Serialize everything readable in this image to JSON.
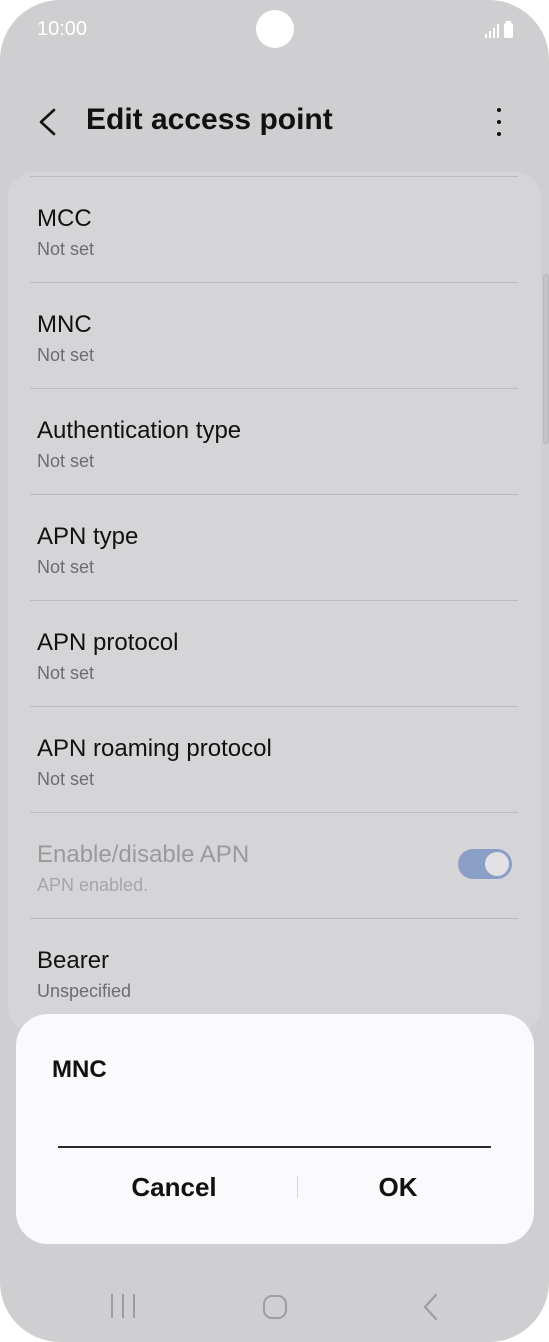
{
  "status_bar": {
    "time": "10:00"
  },
  "header": {
    "title": "Edit access point",
    "back_icon": "back-chevron-icon",
    "more_icon": "more-vertical-icon"
  },
  "list": {
    "items": [
      {
        "title": "MCC",
        "subtitle": "Not set"
      },
      {
        "title": "MNC",
        "subtitle": "Not set"
      },
      {
        "title": "Authentication type",
        "subtitle": "Not set"
      },
      {
        "title": "APN type",
        "subtitle": "Not set"
      },
      {
        "title": "APN protocol",
        "subtitle": "Not set"
      },
      {
        "title": "APN roaming protocol",
        "subtitle": "Not set"
      },
      {
        "title": "Enable/disable APN",
        "subtitle": "APN enabled.",
        "toggle_on": true,
        "disabled": true
      },
      {
        "title": "Bearer",
        "subtitle": "Unspecified"
      }
    ]
  },
  "dialog": {
    "title": "MNC",
    "input_value": "",
    "cancel_label": "Cancel",
    "ok_label": "OK"
  },
  "nav_bar": {
    "recents_icon": "recents-icon",
    "home_icon": "home-icon",
    "back_icon": "nav-back-icon"
  },
  "colors": {
    "background": "#cfcfd1",
    "card": "#d5d5d7",
    "dialog": "#fafafc",
    "toggle": "#8a9ec6"
  }
}
